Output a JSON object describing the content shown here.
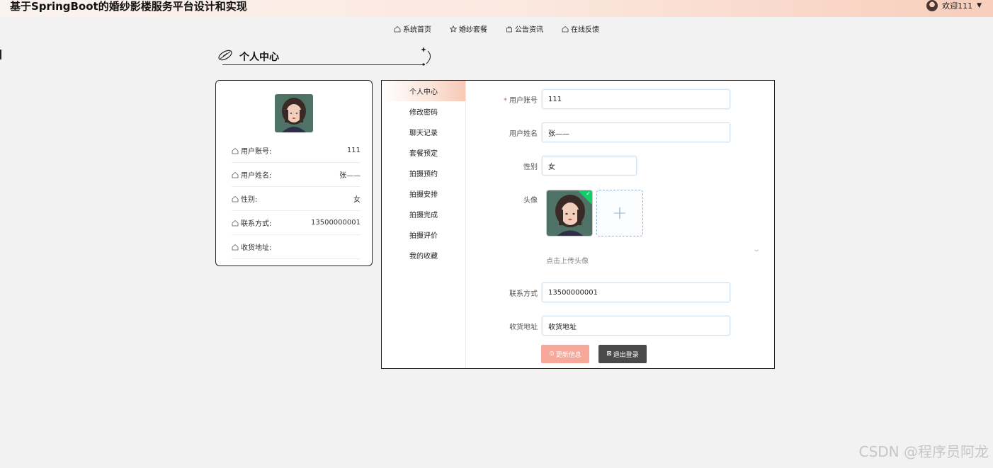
{
  "header": {
    "app_title": "基于SpringBoot的婚纱影楼服务平台设计和实现",
    "welcome": "欢迎111"
  },
  "nav": [
    {
      "label": "系统首页",
      "icon": "home-icon"
    },
    {
      "label": "婚纱套餐",
      "icon": "star-icon"
    },
    {
      "label": "公告资讯",
      "icon": "bag-icon"
    },
    {
      "label": "在线反馈",
      "icon": "home-icon"
    }
  ],
  "section": {
    "title": "个人中心"
  },
  "profile": {
    "rows": [
      {
        "label": "用户账号:",
        "value": "111"
      },
      {
        "label": "用户姓名:",
        "value": "张——"
      },
      {
        "label": "性别:",
        "value": "女"
      },
      {
        "label": "联系方式:",
        "value": "13500000001"
      },
      {
        "label": "收货地址:",
        "value": ""
      }
    ]
  },
  "menu": [
    "个人中心",
    "修改密码",
    "聊天记录",
    "套餐预定",
    "拍摄预约",
    "拍摄安排",
    "拍摄完成",
    "拍摄评价",
    "我的收藏"
  ],
  "form": {
    "account_label": "用户账号",
    "account_value": "111",
    "name_label": "用户姓名",
    "name_value": "张——",
    "gender_label": "性别",
    "gender_value": "女",
    "avatar_label": "头像",
    "upload_plus": "+",
    "upload_hint": "点击上传头像",
    "phone_label": "联系方式",
    "phone_value": "13500000001",
    "address_label": "收货地址",
    "address_value": "收货地址",
    "update_button": "更新信息",
    "logout_button": "退出登录"
  },
  "watermark": "CSDN @程序员阿龙",
  "colors": {
    "accent": "#f7a89a",
    "dark_button": "#4a4a4a",
    "active_menu": "#f7c9b6"
  }
}
